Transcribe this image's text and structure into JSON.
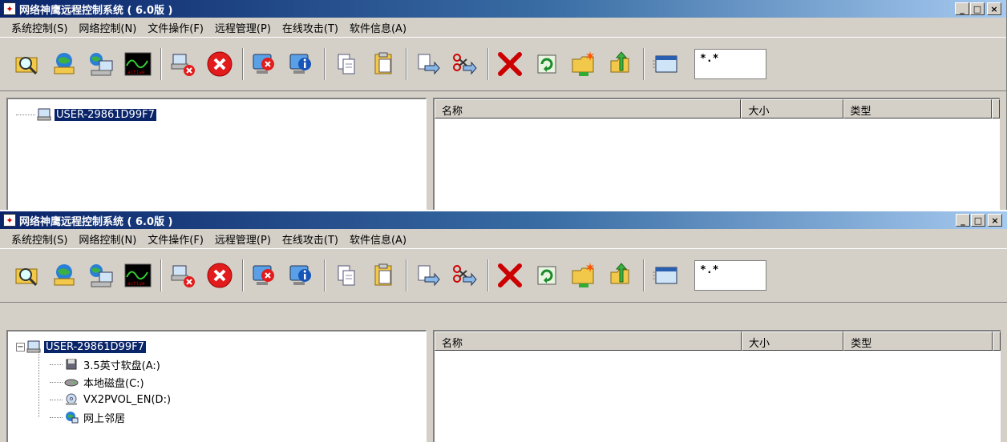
{
  "window": {
    "title": "网络神鹰远程控制系统 ( 6.0版 )",
    "buttons": {
      "minimize": "_",
      "maximize": "□",
      "close": "×"
    }
  },
  "menu": [
    "系统控制(S)",
    "网络控制(N)",
    "文件操作(F)",
    "远程管理(P)",
    "在线攻击(T)",
    "软件信息(A)"
  ],
  "toolbar": {
    "filter_value": "*.*",
    "icons": [
      "search-host-icon",
      "network-host-icon",
      "network-neighborhood-icon",
      "monitor-graph-icon",
      "disconnect-host-icon",
      "stop-icon",
      "remote-stop-icon",
      "info-icon",
      "copy-icon",
      "paste-icon",
      "send-file-icon",
      "cut-send-icon",
      "delete-icon",
      "refresh-icon",
      "new-folder-icon",
      "up-folder-icon",
      "window-icon"
    ],
    "colors": {
      "stop_red": "#e21c1c",
      "delete_red": "#cc0000",
      "folder_yellow": "#f2c84b",
      "globe_blue": "#2a7fd6"
    }
  },
  "tree": {
    "root": "USER-29861D99F7",
    "root_expander": "−",
    "children": [
      {
        "label": "3.5英寸软盘(A:)",
        "icon": "floppy-drive-icon"
      },
      {
        "label": "本地磁盘(C:)",
        "icon": "hard-disk-icon"
      },
      {
        "label": "VX2PVOL_EN(D:)",
        "icon": "cd-drive-icon"
      },
      {
        "label": "网上邻居",
        "icon": "network-places-icon"
      }
    ]
  },
  "list": {
    "columns": [
      "名称",
      "大小",
      "类型"
    ]
  },
  "selection_color": "#0a246a"
}
